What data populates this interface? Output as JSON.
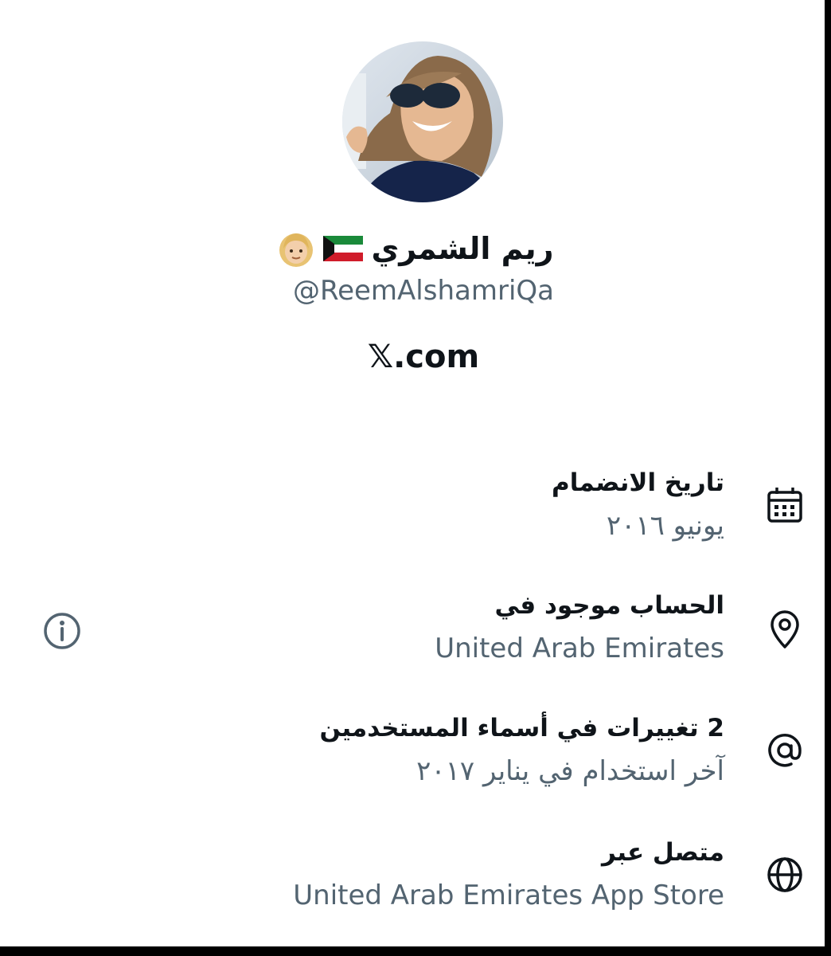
{
  "profile": {
    "display_name": "ريم الشمري",
    "flag_icon": "kuwait-flag-icon",
    "emoji_icon": "blond-woman-emoji-icon",
    "handle": "@ReemAlshamriQa",
    "site": "𝕏.com"
  },
  "details": [
    {
      "icon": "calendar-icon",
      "title": "تاريخ الانضمام",
      "value": "يونيو ٢٠١٦"
    },
    {
      "icon": "location-pin-icon",
      "title": "الحساب موجود في",
      "value": "United Arab Emirates"
    },
    {
      "icon": "at-sign-icon",
      "title": "2 تغييرات في أسماء المستخدمين",
      "value": "آخر استخدام في يناير ٢٠١٧"
    },
    {
      "icon": "globe-icon",
      "title": "متصل عبر",
      "value": "United Arab Emirates App Store"
    }
  ],
  "info_icon": "info-icon",
  "colors": {
    "text_primary": "#0f1419",
    "text_secondary": "#536471",
    "background": "#ffffff"
  }
}
